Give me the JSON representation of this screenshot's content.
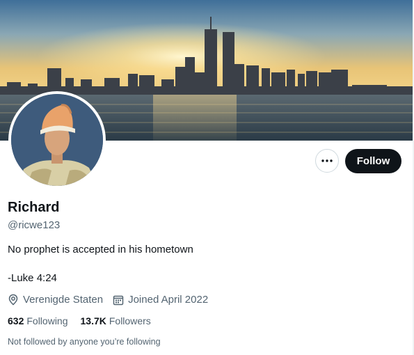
{
  "profile": {
    "name": "Richard",
    "handle": "@ricwe123",
    "bio_line1": "No prophet is accepted in his hometown",
    "bio_line2": "-Luke 4:24",
    "location": "Verenigde Staten",
    "joined": "Joined April 2022",
    "following_count": "632",
    "following_label": "Following",
    "followers_count": "13.7K",
    "followers_label": "Followers",
    "mutuals_note": "Not followed by anyone you’re following"
  },
  "actions": {
    "follow_label": "Follow",
    "more_icon": "more-horizontal-icon"
  },
  "icons": {
    "location": "location-pin-icon",
    "joined": "calendar-icon"
  },
  "colors": {
    "primary_text": "#0f1419",
    "secondary_text": "#536471",
    "follow_button_bg": "#0f1419",
    "follow_button_text": "#ffffff",
    "border": "#cfd9de"
  }
}
